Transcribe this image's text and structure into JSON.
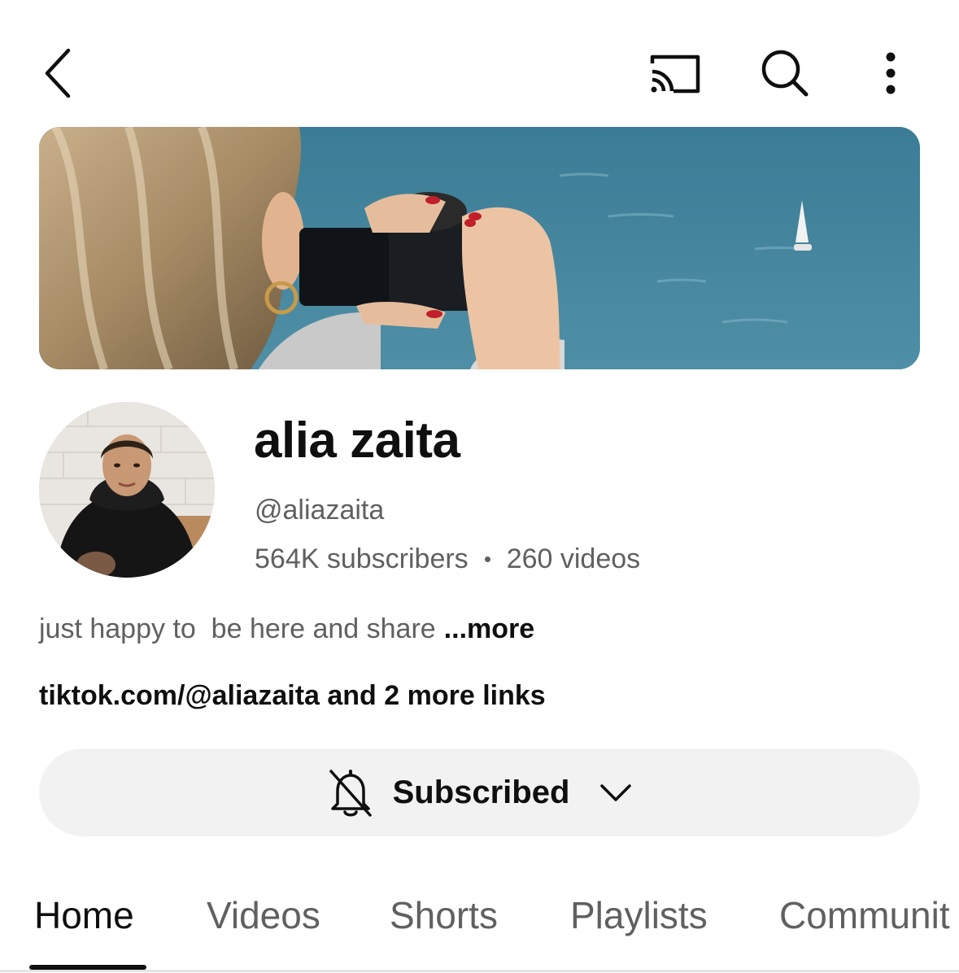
{
  "topbar": {
    "icons": [
      "back-arrow-icon",
      "cast-icon",
      "search-icon",
      "more-vert-icon"
    ]
  },
  "channel": {
    "name": "alia zaita",
    "handle": "@aliazaita",
    "subscribers": "564K subscribers",
    "videos": "260 videos",
    "description": "just happy to  be here and share",
    "more_label": "...more",
    "links": "tiktok.com/@aliazaita and 2 more links"
  },
  "subscribe": {
    "label": "Subscribed",
    "bell_icon": "notifications-off-icon",
    "chevron_icon": "chevron-down-icon"
  },
  "tabs": [
    {
      "label": "Home",
      "active": true
    },
    {
      "label": "Videos",
      "active": false
    },
    {
      "label": "Shorts",
      "active": false
    },
    {
      "label": "Playlists",
      "active": false
    },
    {
      "label": "Communit",
      "active": false
    }
  ],
  "colors": {
    "text_primary": "#0f0f0f",
    "text_secondary": "#606060",
    "button_bg": "#f2f2f2",
    "background": "#ffffff"
  }
}
